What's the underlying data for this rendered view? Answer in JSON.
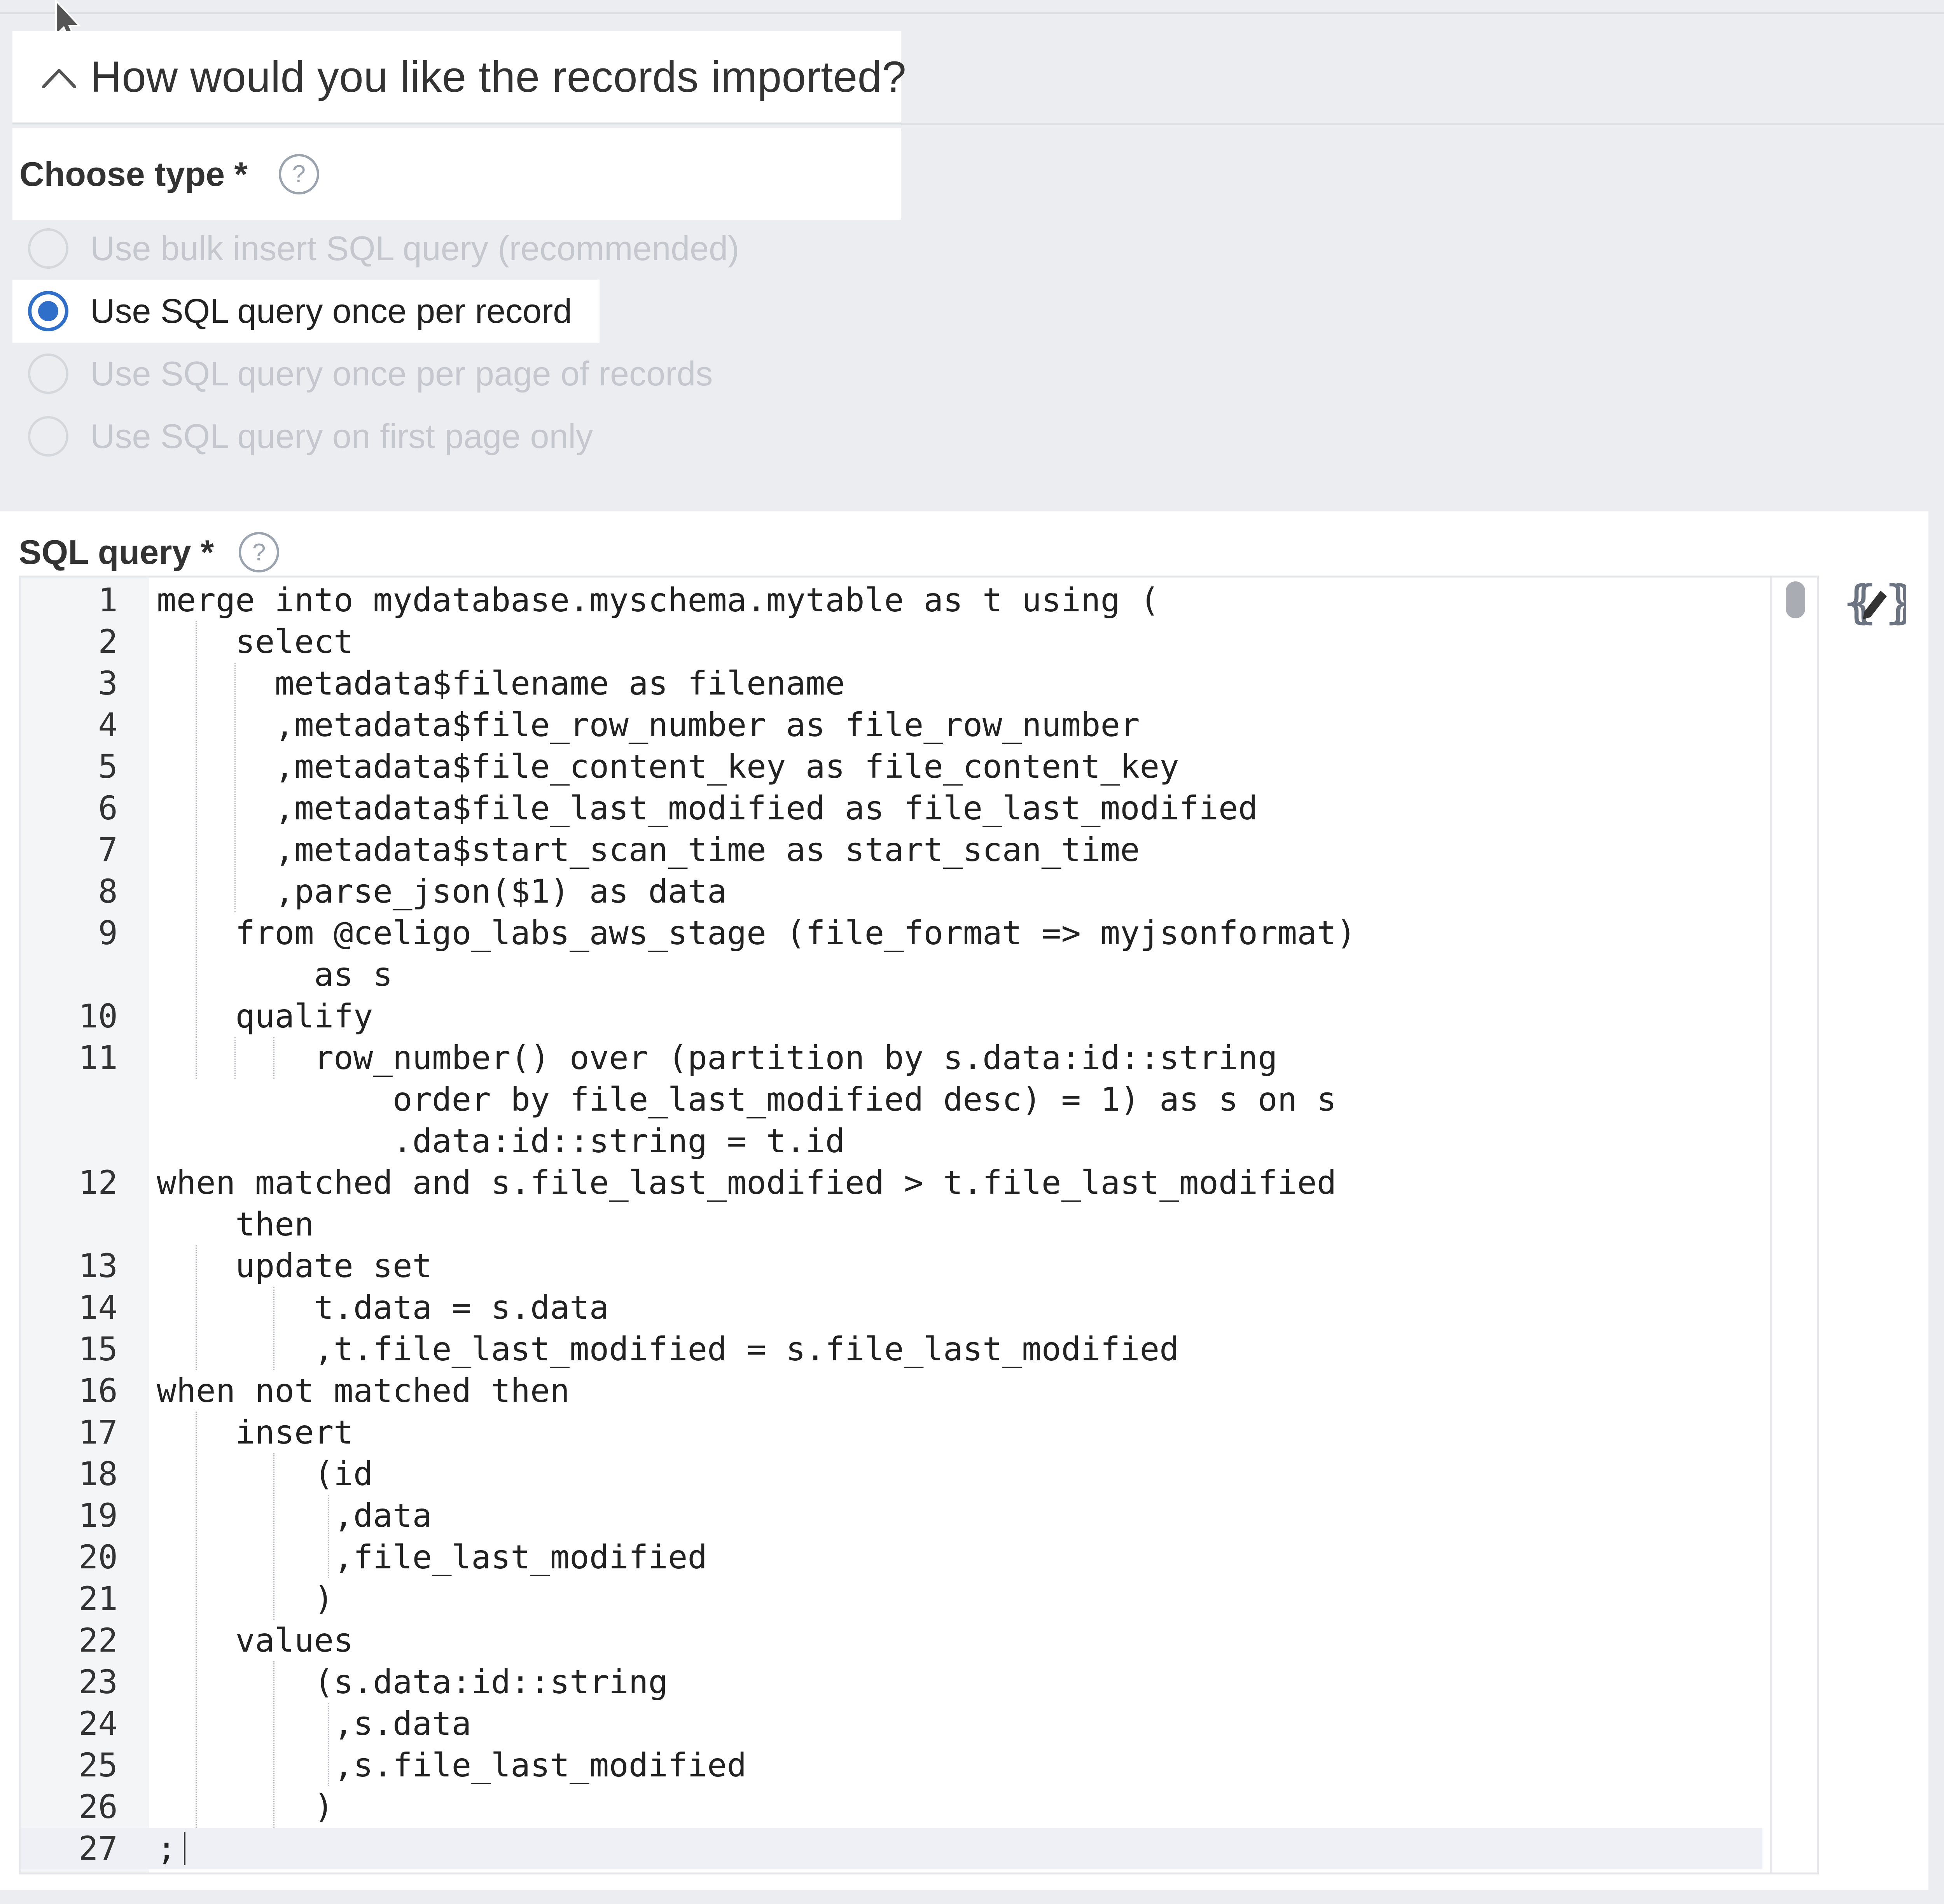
{
  "section": {
    "title": "How would you like the records imported?"
  },
  "choose_type": {
    "label": "Choose type *",
    "help": "?",
    "options": [
      {
        "label": "Use bulk insert SQL query (recommended)",
        "selected": false,
        "disabled": true
      },
      {
        "label": "Use SQL query once per record",
        "selected": true,
        "disabled": false
      },
      {
        "label": "Use SQL query once per page of records",
        "selected": false,
        "disabled": true
      },
      {
        "label": "Use SQL query on first page only",
        "selected": false,
        "disabled": true
      }
    ]
  },
  "sql_query": {
    "label": "SQL query *",
    "help": "?",
    "editor_button_icon": "handlebars-edit-icon",
    "lines": [
      {
        "number": "1",
        "code": "merge into mydatabase.myschema.mytable as t using ("
      },
      {
        "number": "2",
        "code": "    select"
      },
      {
        "number": "3",
        "code": "      metadata$filename as filename"
      },
      {
        "number": "4",
        "code": "      ,metadata$file_row_number as file_row_number"
      },
      {
        "number": "5",
        "code": "      ,metadata$file_content_key as file_content_key"
      },
      {
        "number": "6",
        "code": "      ,metadata$file_last_modified as file_last_modified"
      },
      {
        "number": "7",
        "code": "      ,metadata$start_scan_time as start_scan_time"
      },
      {
        "number": "8",
        "code": "      ,parse_json($1) as data"
      },
      {
        "number": "9",
        "code": "    from @celigo_labs_aws_stage (file_format => myjsonformat)"
      },
      {
        "number": "",
        "code": "        as s"
      },
      {
        "number": "10",
        "code": "    qualify"
      },
      {
        "number": "11",
        "code": "        row_number() over (partition by s.data:id::string"
      },
      {
        "number": "",
        "code": "            order by file_last_modified desc) = 1) as s on s"
      },
      {
        "number": "",
        "code": "            .data:id::string = t.id"
      },
      {
        "number": "12",
        "code": "when matched and s.file_last_modified > t.file_last_modified"
      },
      {
        "number": "",
        "code": "    then"
      },
      {
        "number": "13",
        "code": "    update set"
      },
      {
        "number": "14",
        "code": "        t.data = s.data"
      },
      {
        "number": "15",
        "code": "        ,t.file_last_modified = s.file_last_modified"
      },
      {
        "number": "16",
        "code": "when not matched then"
      },
      {
        "number": "17",
        "code": "    insert"
      },
      {
        "number": "18",
        "code": "        (id"
      },
      {
        "number": "19",
        "code": "         ,data"
      },
      {
        "number": "20",
        "code": "         ,file_last_modified"
      },
      {
        "number": "21",
        "code": "        )"
      },
      {
        "number": "22",
        "code": "    values"
      },
      {
        "number": "23",
        "code": "        (s.data:id::string"
      },
      {
        "number": "24",
        "code": "         ,s.data"
      },
      {
        "number": "25",
        "code": "         ,s.file_last_modified"
      },
      {
        "number": "26",
        "code": "        )"
      },
      {
        "number": "27",
        "code": ";"
      }
    ],
    "active_line": "27"
  },
  "colors": {
    "accent": "#2f6fca",
    "page_background": "#ebedf0",
    "disabled_text": "#c4c8ce"
  }
}
